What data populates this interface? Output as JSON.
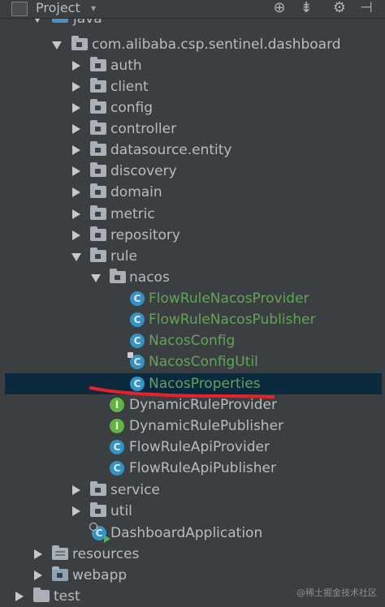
{
  "header": {
    "title": "Project",
    "caret": "▾"
  },
  "tree": {
    "java": "java",
    "package": "com.alibaba.csp.sentinel.dashboard",
    "auth": "auth",
    "client": "client",
    "config": "config",
    "controller": "controller",
    "datasource": "datasource.entity",
    "discovery": "discovery",
    "domain": "domain",
    "metric": "metric",
    "repository": "repository",
    "rule": "rule",
    "nacos": "nacos",
    "flowRuleNacosProvider": "FlowRuleNacosProvider",
    "flowRuleNacosPublisher": "FlowRuleNacosPublisher",
    "nacosConfig": "NacosConfig",
    "nacosConfigUtil": "NacosConfigUtil",
    "nacosProperties": "NacosProperties",
    "dynamicRuleProvider": "DynamicRuleProvider",
    "dynamicRulePublisher": "DynamicRulePublisher",
    "flowRuleApiProvider": "FlowRuleApiProvider",
    "flowRuleApiPublisher": "FlowRuleApiPublisher",
    "service": "service",
    "util": "util",
    "dashboardApplication": "DashboardApplication",
    "resources": "resources",
    "webapp": "webapp",
    "test": "test"
  },
  "icons": {
    "class": "C",
    "interface": "I"
  },
  "colors": {
    "background": "#3c3f41",
    "selection": "#0d293e",
    "git_new_file": "#62a35a",
    "class_icon": "#3592c4",
    "interface_icon": "#62b543",
    "annotation_stroke": "#e8222a"
  },
  "watermark": "@稀土掘金技术社区"
}
